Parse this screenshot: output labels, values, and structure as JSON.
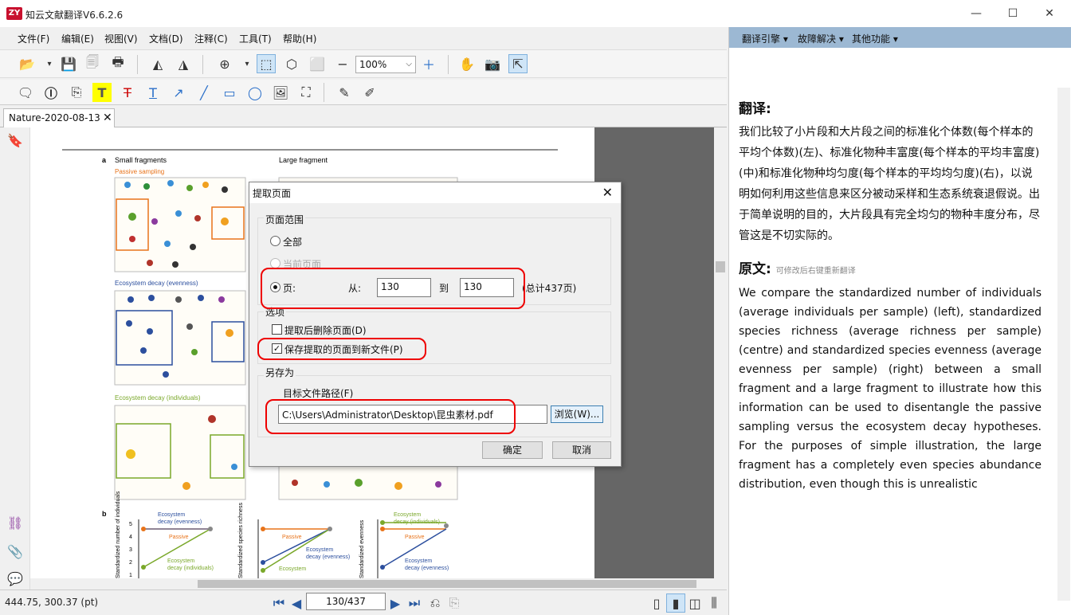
{
  "window": {
    "logo_text": "ZY",
    "title": "知云文献翻译V6.6.2.6",
    "minimize_icon": "—",
    "maximize_icon": "☐",
    "close_icon": "✕"
  },
  "menu": {
    "items": [
      "文件(F)",
      "编辑(E)",
      "视图(V)",
      "文档(D)",
      "注释(C)",
      "工具(T)",
      "帮助(H)"
    ]
  },
  "toolbar": {
    "zoom_value": "100%"
  },
  "document_tab": {
    "label": "Nature-2020-08-13",
    "close_icon": "✕"
  },
  "figure": {
    "panel_a_label": "a",
    "panel_b_label": "b",
    "small_fragments": "Small fragments",
    "large_fragment": "Large fragment",
    "passive_sampling": "Passive sampling",
    "eco_evenness": "Ecosystem decay (evenness)",
    "eco_individuals": "Ecosystem decay (individuals)",
    "b_y1": "Standardized number of individuals",
    "b_y2": "Standardized species richness",
    "b_y3": "Standardized evenness",
    "b_eco_even_line1": "Ecosystem",
    "b_eco_even_line2": "decay (evenness)",
    "b_eco_ind_line1": "Ecosystem",
    "b_eco_ind_line2": "decay (individuals)",
    "b_passive": "Passive",
    "b_ticks": [
      "5",
      "4",
      "3",
      "2",
      "1"
    ],
    "colors": {
      "passive": "#e8731a",
      "evenness": "#2c4f9e",
      "individuals": "#7aa82a"
    }
  },
  "status": {
    "coords": "444.75, 300.37 (pt)",
    "page": "130/437"
  },
  "right_panel": {
    "menus": [
      "翻译引擎 ▾",
      "故障解决 ▾",
      "其他功能 ▾"
    ],
    "translation_heading": "翻译:",
    "translation_text": "我们比较了小片段和大片段之间的标准化个体数(每个样本的平均个体数)(左)、标准化物种丰富度(每个样本的平均丰富度)(中)和标准化物种均匀度(每个样本的平均均匀度)(右)，以说明如何利用这些信息来区分被动采样和生态系统衰退假说。出于简单说明的目的，大片段具有完全均匀的物种丰度分布，尽管这是不切实际的。",
    "original_heading": "原文:",
    "original_hint": "可修改后右键重新翻译",
    "original_text": "We compare the standardized number of individuals (average individuals per sample) (left), standardized species richness (average richness per sample) (centre) and standardized species evenness (average evenness per sample) (right) between a small fragment and a large fragment to illustrate how this information can be used to disentangle the passive sampling versus the ecosystem decay hypotheses. For the purposes of simple illustration, the large fragment has a completely even species abundance distribution, even though this is unrealistic"
  },
  "dialog": {
    "title": "提取页面",
    "close_icon": "✕",
    "range_group": "页面范围",
    "all_label": "全部",
    "current_label": "当前页面",
    "pages_label": "页:",
    "from_label": "从:",
    "from_value": "130",
    "to_label": "到",
    "to_value": "130",
    "total_label": "(总计437页)",
    "options_group": "选项",
    "delete_after_label": "提取后删除页面(D)",
    "save_new_label": "保存提取的页面到新文件(P)",
    "save_new_checked": "✓",
    "saveas_group": "另存为",
    "path_label": "目标文件路径(F)",
    "path_value": "C:\\Users\\Administrator\\Desktop\\昆虫素材.pdf",
    "browse_label": "浏览(W)...",
    "ok_label": "确定",
    "cancel_label": "取消"
  }
}
